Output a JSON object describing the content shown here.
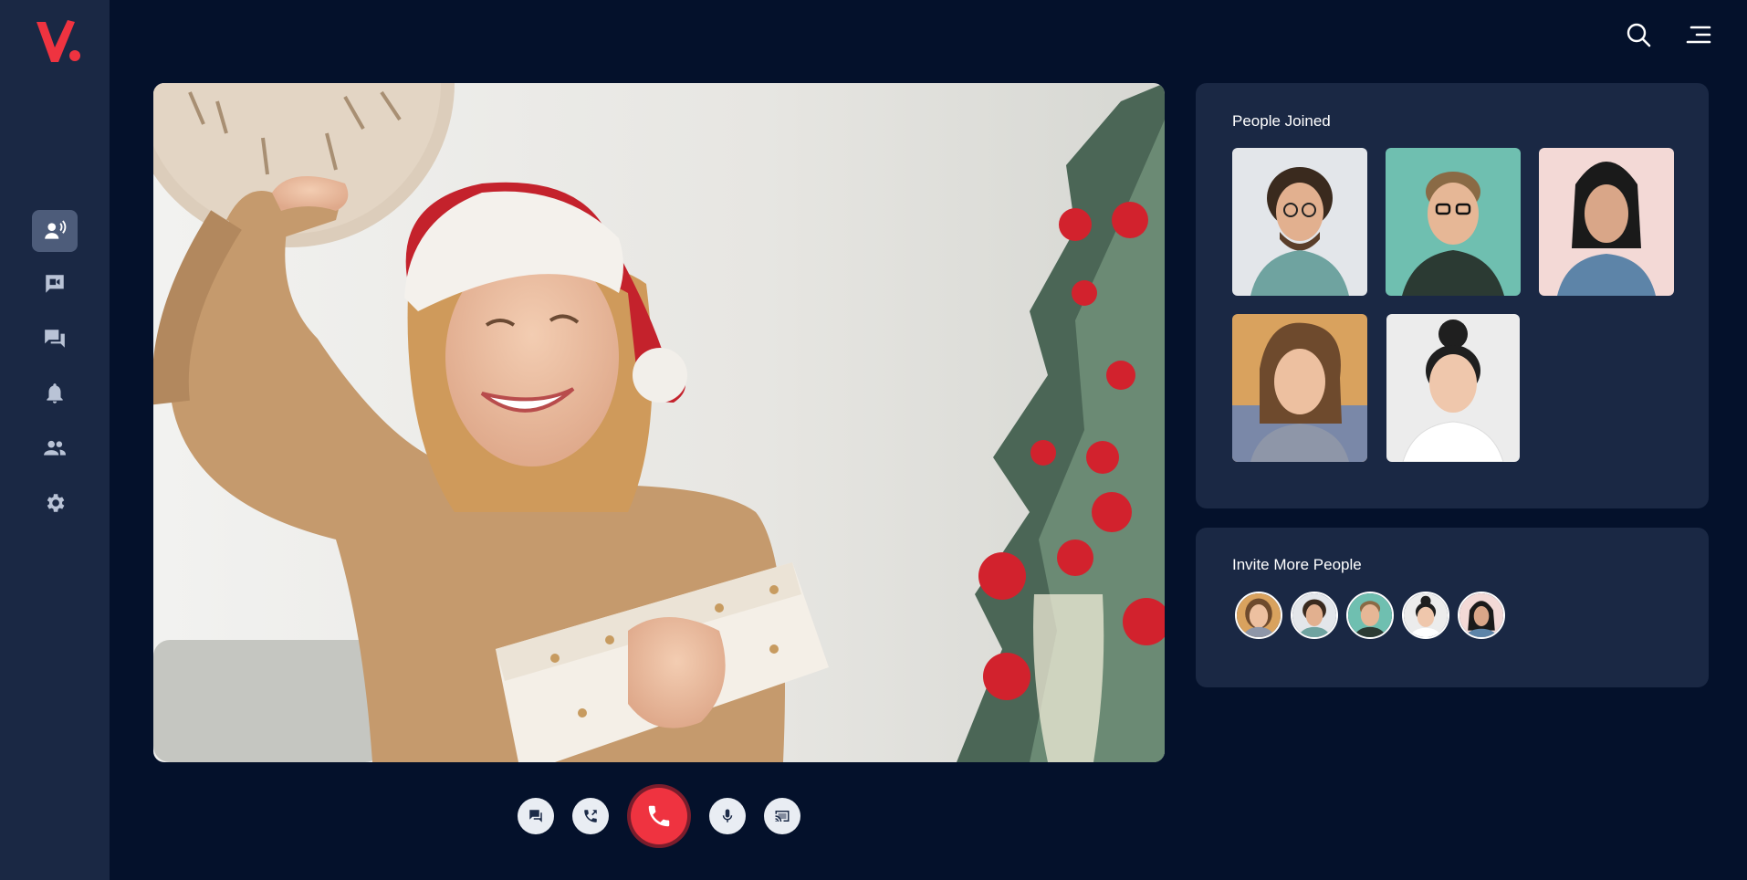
{
  "app": {
    "brand": "V."
  },
  "sidebar": {
    "items": [
      {
        "icon": "voice-call-icon",
        "active": true
      },
      {
        "icon": "video-chat-icon",
        "active": false
      },
      {
        "icon": "messages-icon",
        "active": false
      },
      {
        "icon": "bell-icon",
        "active": false
      },
      {
        "icon": "people-icon",
        "active": false
      },
      {
        "icon": "gear-icon",
        "active": false
      }
    ]
  },
  "header": {
    "icons": [
      "search-icon",
      "menu-icon"
    ]
  },
  "call": {
    "controls": [
      "chat-icon",
      "phone-forward-icon",
      "end-call-icon",
      "microphone-icon",
      "screen-share-icon"
    ],
    "end_color": "#ef3340"
  },
  "people_joined": {
    "title": "People Joined",
    "count": 5
  },
  "invite": {
    "title": "Invite More People",
    "count": 5
  },
  "colors": {
    "background": "#04112b",
    "panel": "#1a2844",
    "accent": "#ef3340"
  }
}
